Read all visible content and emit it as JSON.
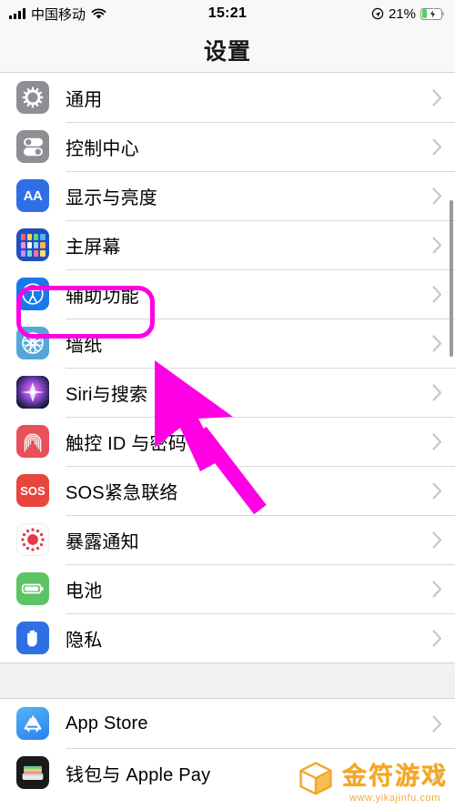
{
  "statusbar": {
    "carrier": "中国移动",
    "time": "15:21",
    "battery_percent": "21%",
    "signal_icon": "signal-bars-icon",
    "wifi_icon": "wifi-icon",
    "location_icon": "location-arrow-icon",
    "battery_icon": "battery-charging-icon",
    "battery_level": 21,
    "charging": true
  },
  "navbar": {
    "title": "设置"
  },
  "groups": [
    {
      "rows": [
        {
          "label": "通用",
          "icon": "gear-icon",
          "icon_class": "ic-general",
          "highlighted": false
        },
        {
          "label": "控制中心",
          "icon": "toggles-icon",
          "icon_class": "ic-control",
          "highlighted": false
        },
        {
          "label": "显示与亮度",
          "icon": "display-aa-icon",
          "icon_class": "ic-display",
          "highlighted": false
        },
        {
          "label": "主屏幕",
          "icon": "home-screen-grid-icon",
          "icon_class": "ic-home",
          "highlighted": false
        },
        {
          "label": "辅助功能",
          "icon": "accessibility-icon",
          "icon_class": "ic-access",
          "highlighted": true
        },
        {
          "label": "墙纸",
          "icon": "wallpaper-flower-icon",
          "icon_class": "ic-wall",
          "highlighted": false
        },
        {
          "label": "Siri与搜索",
          "icon": "siri-icon",
          "icon_class": "ic-siri",
          "highlighted": false
        },
        {
          "label": "触控 ID 与密码",
          "icon": "fingerprint-icon",
          "icon_class": "ic-touch",
          "highlighted": false
        },
        {
          "label": "SOS紧急联络",
          "icon": "sos-icon",
          "icon_class": "ic-sos",
          "highlighted": false
        },
        {
          "label": "暴露通知",
          "icon": "exposure-notification-icon",
          "icon_class": "ic-expo",
          "highlighted": false
        },
        {
          "label": "电池",
          "icon": "battery-icon",
          "icon_class": "ic-batt",
          "highlighted": false
        },
        {
          "label": "隐私",
          "icon": "privacy-hand-icon",
          "icon_class": "ic-priv",
          "highlighted": false
        }
      ]
    },
    {
      "rows": [
        {
          "label": "App Store",
          "icon": "app-store-icon",
          "icon_class": "ic-appstore",
          "highlighted": false
        },
        {
          "label": "钱包与 Apple Pay",
          "icon": "wallet-icon",
          "icon_class": "ic-wallet",
          "highlighted": false
        }
      ]
    }
  ],
  "chevron_icon": "chevron-right-icon",
  "cursor": {
    "icon": "mouse-pointer-arrow",
    "color": "#ff00e4"
  },
  "highlight": {
    "color": "#ff00e4",
    "target_label": "辅助功能"
  },
  "watermark": {
    "title": "金符游戏",
    "url": "www.yikajinfu.com",
    "icon": "cube-logo-icon",
    "color": "#f5a623"
  }
}
